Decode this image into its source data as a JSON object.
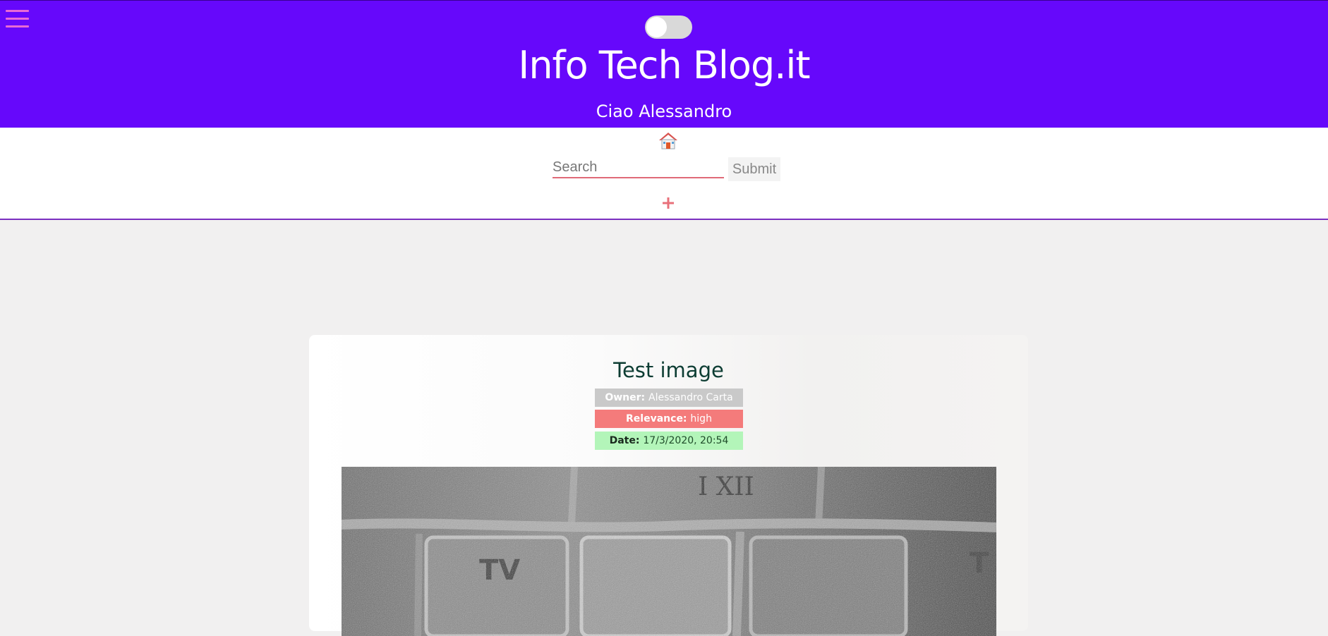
{
  "header": {
    "title": "Info Tech Blog.it",
    "greeting": "Ciao Alessandro",
    "colors": {
      "background": "#6608fb",
      "menu_icon": "#e86ad4"
    }
  },
  "theme_toggle": {
    "state": "off"
  },
  "nav": {
    "home_icon": "house-icon",
    "search": {
      "placeholder": "Search",
      "value": ""
    },
    "submit_label": "Submit",
    "add_icon": "plus-icon"
  },
  "post": {
    "title": "Test image",
    "owner_label": "Owner:",
    "owner_value": "Alessandro Carta",
    "relevance_label": "Relevance:",
    "relevance_value": "high",
    "date_label": "Date:",
    "date_value": "17/3/2020, 20:54",
    "colors": {
      "title": "#0d3d33",
      "relevance": "#f47b7b",
      "date": "#b3f5b9",
      "owner": "#c9c9c9"
    }
  }
}
